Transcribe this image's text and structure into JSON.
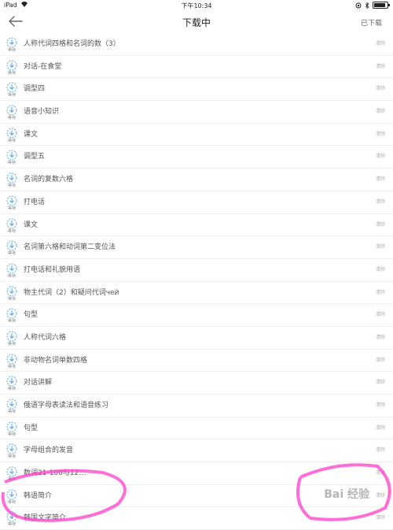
{
  "status_bar": {
    "device": "iPad",
    "time": "下午10:34",
    "battery_level": 0.85
  },
  "nav": {
    "title": "下载中",
    "right_action": "已下载"
  },
  "item_status": "等待",
  "delete_label": "清除",
  "items": [
    "人称代词四格和名词的数（3）",
    "对话-在食堂",
    "调型四",
    "语音小知识",
    "课文",
    "调型五",
    "名词的复数六格",
    "打电话",
    "课文",
    "名词第六格和动词第二变位法",
    "打电话和礼貌用语",
    "物主代词（2）和疑问代词чей",
    "句型",
    "人称代词六格",
    "非动物名词单数四格",
    "对话讲解",
    "俄语字母表读法和语音练习",
    "句型",
    "字母组合的发音",
    "数词21-100与12…",
    "韩语简介",
    "韩国文字简介"
  ],
  "colors": {
    "icon_blue": "#5aa9e6",
    "highlight": "#ff3cc8"
  },
  "icons": {
    "back": "arrow-left-icon",
    "status": "download-waiting-icon",
    "wifi": "wifi-icon",
    "battery": "battery-icon"
  },
  "watermark": "Bai 经验"
}
